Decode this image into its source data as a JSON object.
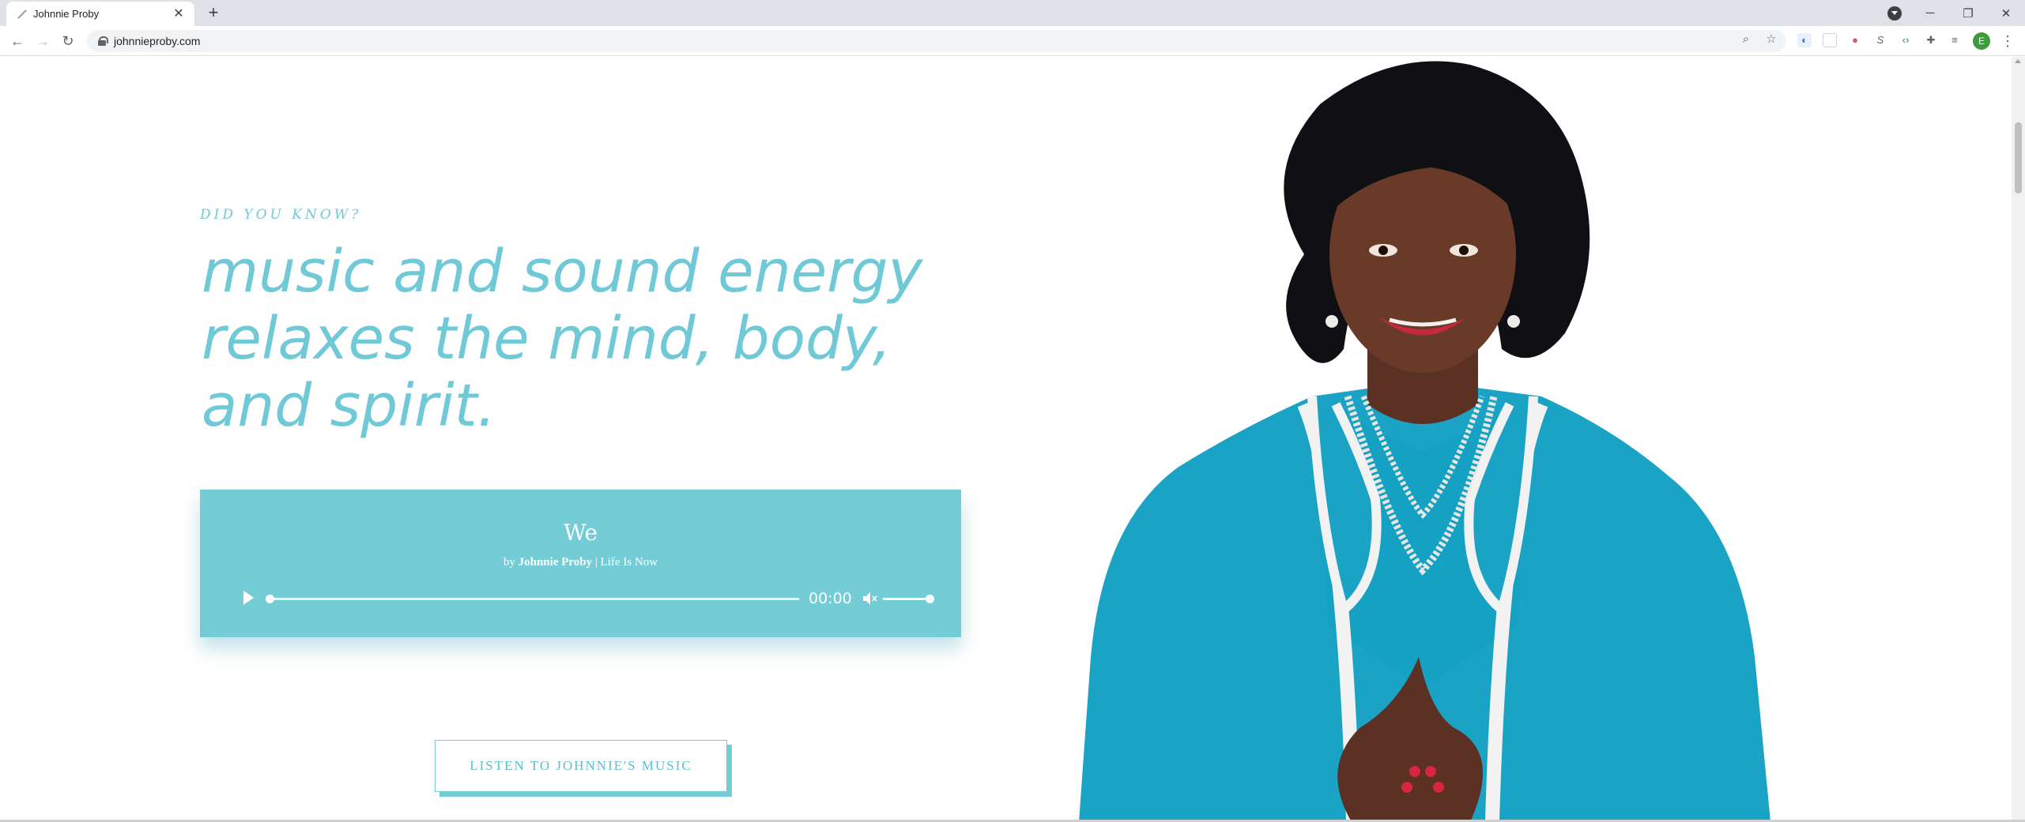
{
  "browser": {
    "tab_title": "Johnnie Proby",
    "tab_close": "✕",
    "new_tab": "+",
    "url": "johnnieproby.com",
    "profile_initial": "E"
  },
  "hero": {
    "eyebrow": "DID YOU KNOW?",
    "headline": "music and sound energy relaxes the mind, body, and spirit."
  },
  "player": {
    "title": "We",
    "by_prefix": "by",
    "artist": "Johnnie Proby",
    "separator": "|",
    "album": "Life Is Now",
    "time": "00:00",
    "progress": 0.0,
    "volume": 1.0
  },
  "cta": {
    "label": "LISTEN TO JOHNNIE'S MUSIC"
  },
  "colors": {
    "accent": "#6fc9d6",
    "player_bg": "#74ccd6",
    "jacket": "#1aa3c5"
  },
  "icons": [
    "back-arrow-icon",
    "forward-arrow-icon",
    "reload-icon",
    "lock-icon",
    "zoom-icon",
    "bookmark-star-icon",
    "play-icon",
    "mute-icon",
    "extensions-puzzle-icon"
  ]
}
